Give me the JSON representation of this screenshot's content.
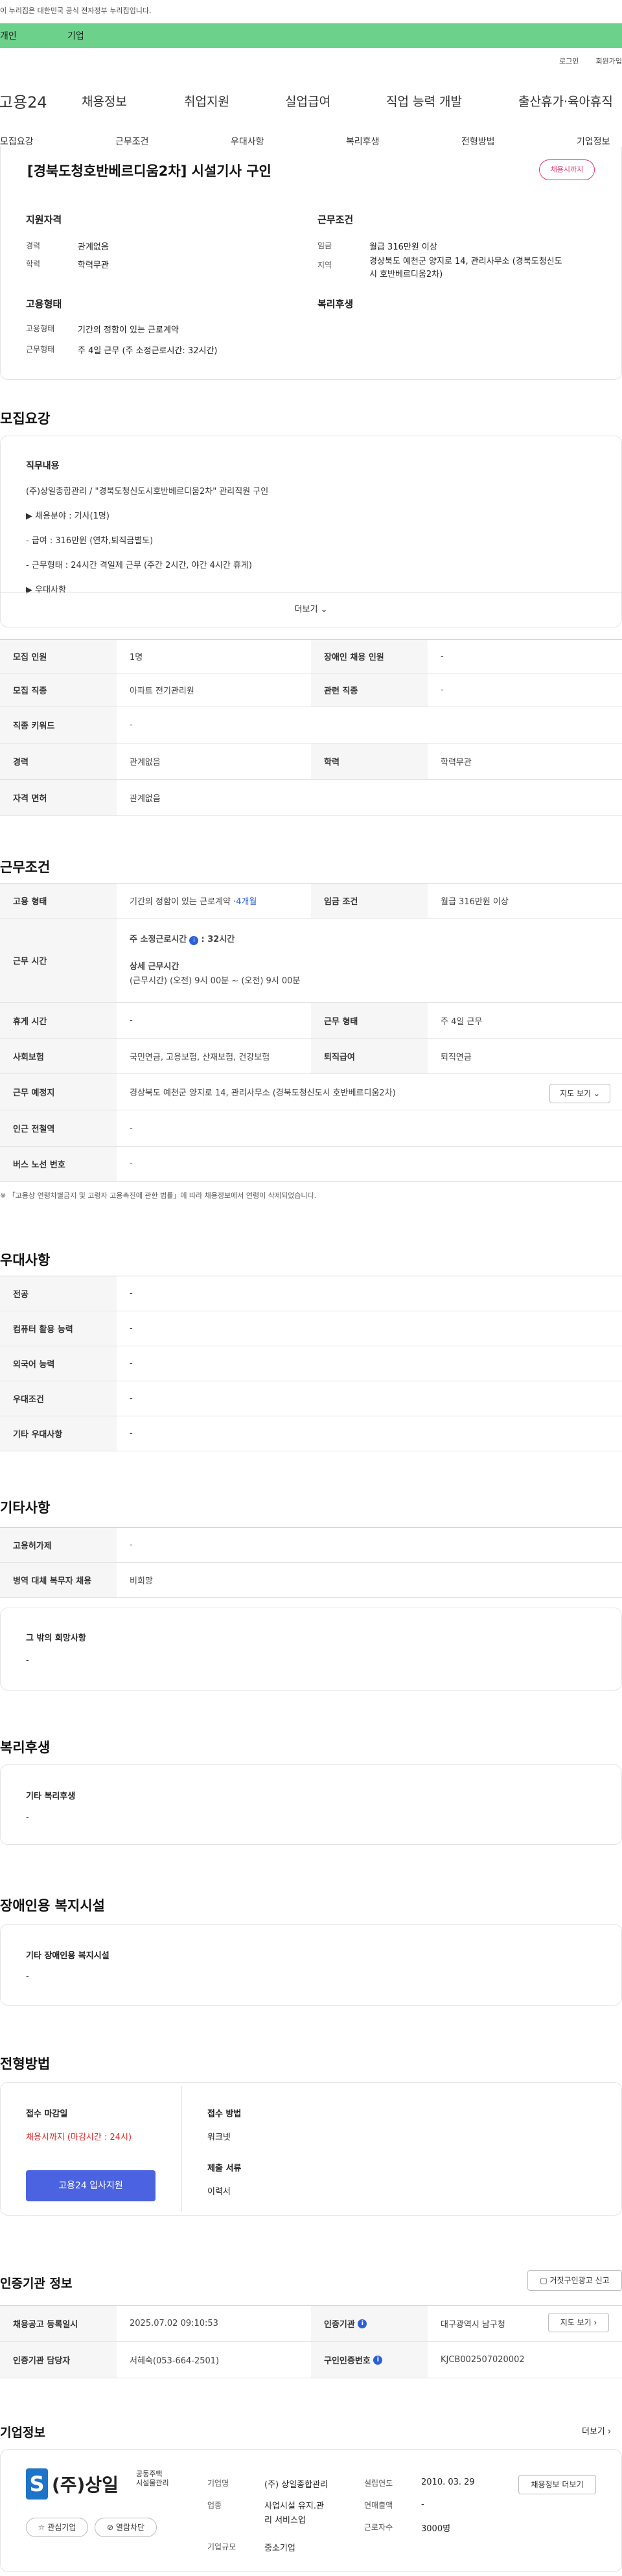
{
  "gov_banner": "이 누리집은 대한민국 공식 전자정부 누리집입니다.",
  "green_tabs": [
    "개인",
    "기업"
  ],
  "util": [
    "로그인",
    "회원가입"
  ],
  "logo": "고용24",
  "gnb": [
    "채용정보",
    "취업지원",
    "실업급여",
    "직업 능력 개발",
    "출산휴가·육아휴직"
  ],
  "tabs": [
    "모집요강",
    "근무조건",
    "우대사항",
    "복리후생",
    "전형방법",
    "기업정보"
  ],
  "job": {
    "title": "[경북도청호반베르디움2차] 시설기사 구인",
    "badge": "채용시까지"
  },
  "summary": {
    "qual_title": "지원자격",
    "cond_title": "근무조건",
    "emp_title": "고용형태",
    "welfare_title": "복리후생",
    "career_label": "경력",
    "career_value": "관계없음",
    "edu_label": "학력",
    "edu_value": "학력무관",
    "wage_label": "임금",
    "wage_value": "월급 316만원 이상",
    "region_label": "지역",
    "region_value1": "경상북도 예천군 양지로 14, 관리사무소 (경북도청신도",
    "region_value2": "시 호반베르디움2차)",
    "emptype_label": "고용형태",
    "emptype_value": "기간의 정함이 있는 근로계약",
    "worktype_label": "근무형태",
    "worktype_value": "주 4일 근무 (주 소정근로시간: 32시간)"
  },
  "recruit": {
    "section_title": "모집요강",
    "duty_title": "직무내용",
    "lines": [
      "(주)상일종합관리 / \"경북도청신도시호반베르디움2차\" 관리직원 구인",
      "▶ 채용분야 : 기사(1명)",
      "- 급여 : 316만원 (연차,퇴직금별도)",
      "- 근무형태 : 24시간 격일제 근무 (주간 2시간, 야간 4시간 휴게)",
      "▶ 우대사항"
    ],
    "more": "더보기",
    "rows": [
      [
        "모집 인원",
        "1명",
        "장애인 채용 인원",
        "-"
      ],
      [
        "모집 직종",
        "아파트 전기관리원",
        "관련 직종",
        "-"
      ],
      [
        "직종 키워드",
        "-",
        "",
        ""
      ],
      [
        "경력",
        "관계없음",
        "학력",
        "학력무관"
      ],
      [
        "자격 면허",
        "관계없음",
        "",
        ""
      ]
    ]
  },
  "conditions": {
    "section_title": "근무조건",
    "emptype_label": "고용 형태",
    "emptype_value": "기간의 정함이 있는 근로계약 · ",
    "emptype_period": "4개월",
    "wage_label": "임금 조건",
    "wage_value": "월급 316만원 이상",
    "hours_label": "근무 시간",
    "hours_title": "주 소정근로시간",
    "hours_value": ": 32시간",
    "hours_detail_title": "상세 근무시간",
    "hours_detail": "(근무시간) (오전) 9시 00분 ~ (오전) 9시 00분",
    "rest_label": "휴게 시간",
    "rest_value": "-",
    "worktype_label": "근무 형태",
    "worktype_value": "주 4일 근무",
    "ins_label": "사회보험",
    "ins_value": "국민연금, 고용보험, 산재보험, 건강보험",
    "sev_label": "퇴직급여",
    "sev_value": "퇴직연금",
    "place_label": "근무 예정지",
    "place_value": "경상북도 예천군 양지로 14, 관리사무소 (경북도청신도시 호반베르디움2차)",
    "map_btn": "지도 보기",
    "subway_label": "인근 전철역",
    "subway_value": "-",
    "bus_label": "버스 노선 번호",
    "bus_value": "-",
    "note": "※ 「고용상 연령차별금지 및 고령자 고용촉진에 관한 법률」에 따라 채용정보에서 연령이 삭제되었습니다."
  },
  "pref": {
    "section_title": "우대사항",
    "rows": [
      [
        "전공",
        "-"
      ],
      [
        "컴퓨터 활용 능력",
        "-"
      ],
      [
        "외국어 능력",
        "-"
      ],
      [
        "우대조건",
        "-"
      ],
      [
        "기타 우대사항",
        "-"
      ]
    ]
  },
  "etc": {
    "section_title": "기타사항",
    "rows": [
      [
        "고용허가제",
        "-"
      ],
      [
        "병역 대체 복무자 채용",
        "비희망"
      ]
    ],
    "other_title": "그 밖의 희망사항",
    "other_value": "-"
  },
  "welfare": {
    "section_title": "복리후생",
    "box_title": "기타 복리후생",
    "box_value": "-"
  },
  "disability": {
    "section_title": "장애인용 복지시설",
    "box_title": "기타 장애인용 복지시설",
    "box_value": "-"
  },
  "selection": {
    "section_title": "전형방법",
    "deadline_title": "접수 마감일",
    "deadline_value": "채용시까지 (마감시간 : 24시)",
    "apply_btn": "고용24 입사지원",
    "method_title": "접수 방법",
    "method_value": "워크넷",
    "docs_title": "제출 서류",
    "docs_value": "이력서"
  },
  "cert": {
    "section_title": "인증기관 정보",
    "report_btn": "거짓구인광고 신고",
    "reg_label": "채용공고 등록일시",
    "reg_value": "2025.07.02 09:10:53",
    "agency_label": "인증기관",
    "agency_value": "대구광역시 남구청",
    "map_btn": "지도 보기",
    "mgr_label": "인증기관 담당자",
    "mgr_value": "서혜숙(053-664-2501)",
    "num_label": "구인인증번호",
    "num_value": "KJCB002507020002"
  },
  "company": {
    "section_title": "기업정보",
    "more": "더보기",
    "logo_main": "(주)상일",
    "logo_sub1": "공동주택",
    "logo_sub2": "시설물관리",
    "fav_btn": "관심기업",
    "block_btn": "열람차단",
    "name_label": "기업명",
    "name_value": "(주) 상일종합관리",
    "ind_label": "업종",
    "ind_value1": "사업시설 유지.관",
    "ind_value2": "리 서비스업",
    "size_label": "기업규모",
    "size_value": "중소기업",
    "est_label": "설립연도",
    "est_value": "2010. 03. 29",
    "sales_label": "연매출액",
    "sales_value": "-",
    "emp_label": "근로자수",
    "emp_value": "3000명",
    "hire_btn": "채용정보 더보기"
  }
}
